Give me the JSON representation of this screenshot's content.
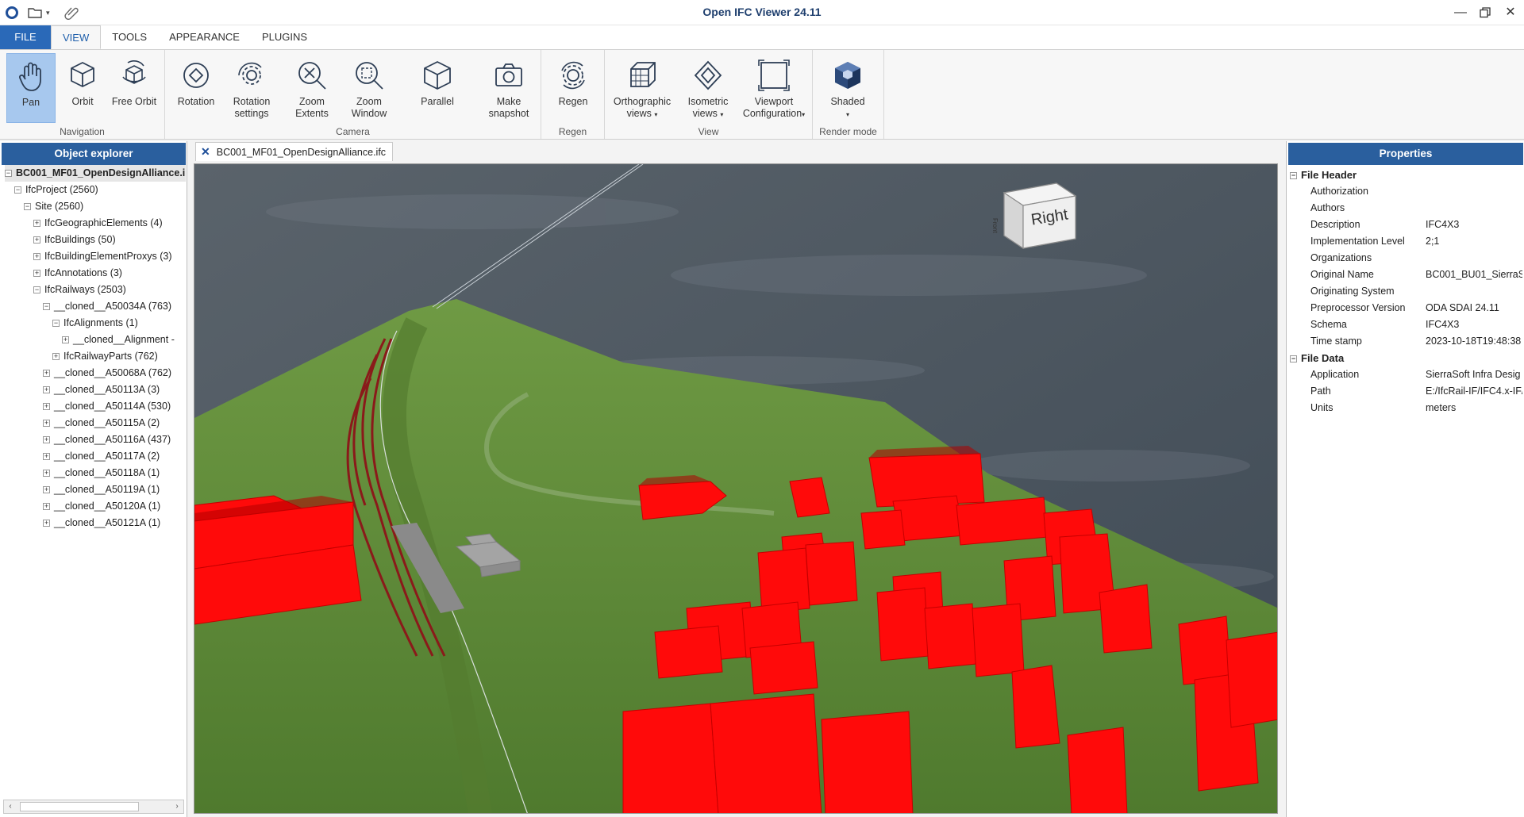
{
  "window": {
    "title": "Open IFC Viewer 24.11"
  },
  "tabs": [
    "FILE",
    "VIEW",
    "TOOLS",
    "APPEARANCE",
    "PLUGINS"
  ],
  "ribbon": {
    "groups": {
      "navigation": "Navigation",
      "camera": "Camera",
      "regen": "Regen",
      "view": "View",
      "render_mode": "Render mode"
    },
    "buttons": {
      "pan": "Pan",
      "orbit": "Orbit",
      "free_orbit": "Free Orbit",
      "rotation": "Rotation",
      "rotation_settings_1": "Rotation",
      "rotation_settings_2": "settings",
      "zoom_extents_1": "Zoom",
      "zoom_extents_2": "Extents",
      "zoom_window_1": "Zoom",
      "zoom_window_2": "Window",
      "parallel": "Parallel",
      "make_snapshot_1": "Make",
      "make_snapshot_2": "snapshot",
      "regen": "Regen",
      "ortho_1": "Orthographic",
      "ortho_2": "views",
      "iso_1": "Isometric",
      "iso_2": "views",
      "vpconf_1": "Viewport",
      "vpconf_2": "Configuration",
      "shaded": "Shaded"
    }
  },
  "object_explorer": {
    "title": "Object explorer",
    "tree": [
      {
        "label": "BC001_MF01_OpenDesignAlliance.i",
        "level": 0,
        "exp": "−",
        "bold": true
      },
      {
        "label": "IfcProject (2560)",
        "level": 1,
        "exp": "−"
      },
      {
        "label": "Site (2560)",
        "level": 2,
        "exp": "−"
      },
      {
        "label": "IfcGeographicElements (4)",
        "level": 3,
        "exp": "+"
      },
      {
        "label": "IfcBuildings (50)",
        "level": 3,
        "exp": "+"
      },
      {
        "label": "IfcBuildingElementProxys (3)",
        "level": 3,
        "exp": "+"
      },
      {
        "label": "IfcAnnotations (3)",
        "level": 3,
        "exp": "+"
      },
      {
        "label": "IfcRailways (2503)",
        "level": 3,
        "exp": "−"
      },
      {
        "label": "__cloned__A50034A (763)",
        "level": 4,
        "exp": "−"
      },
      {
        "label": "IfcAlignments (1)",
        "level": 5,
        "exp": "−"
      },
      {
        "label": "__cloned__Alignment -",
        "level": 6,
        "exp": "+"
      },
      {
        "label": "IfcRailwayParts (762)",
        "level": 5,
        "exp": "+"
      },
      {
        "label": "__cloned__A50068A (762)",
        "level": 4,
        "exp": "+"
      },
      {
        "label": "__cloned__A50113A (3)",
        "level": 4,
        "exp": "+"
      },
      {
        "label": "__cloned__A50114A (530)",
        "level": 4,
        "exp": "+"
      },
      {
        "label": "__cloned__A50115A (2)",
        "level": 4,
        "exp": "+"
      },
      {
        "label": "__cloned__A50116A (437)",
        "level": 4,
        "exp": "+"
      },
      {
        "label": "__cloned__A50117A (2)",
        "level": 4,
        "exp": "+"
      },
      {
        "label": "__cloned__A50118A (1)",
        "level": 4,
        "exp": "+"
      },
      {
        "label": "__cloned__A50119A (1)",
        "level": 4,
        "exp": "+"
      },
      {
        "label": "__cloned__A50120A (1)",
        "level": 4,
        "exp": "+"
      },
      {
        "label": "__cloned__A50121A (1)",
        "level": 4,
        "exp": "+"
      }
    ]
  },
  "document": {
    "tab_label": "BC001_MF01_OpenDesignAlliance.ifc",
    "viewcube_label": "Right",
    "viewcube_side_label": "Front"
  },
  "properties": {
    "title": "Properties",
    "sections": [
      {
        "name": "File Header",
        "rows": [
          {
            "key": "Authorization",
            "value": ""
          },
          {
            "key": "Authors",
            "value": ""
          },
          {
            "key": "Description",
            "value": "IFC4X3"
          },
          {
            "key": "Implementation Level",
            "value": "2;1"
          },
          {
            "key": "Organizations",
            "value": ""
          },
          {
            "key": "Original Name",
            "value": "BC001_BU01_SierraSo"
          },
          {
            "key": "Originating System",
            "value": ""
          },
          {
            "key": "Preprocessor Version",
            "value": "ODA SDAI 24.11"
          },
          {
            "key": "Schema",
            "value": "IFC4X3"
          },
          {
            "key": "Time stamp",
            "value": "2023-10-18T19:48:38"
          }
        ]
      },
      {
        "name": "File Data",
        "rows": [
          {
            "key": "Application",
            "value": "SierraSoft Infra Desig"
          },
          {
            "key": "Path",
            "value": "E:/IfcRail-IF/IFC4.x-IF/"
          },
          {
            "key": "Units",
            "value": "meters"
          }
        ]
      }
    ]
  },
  "colors": {
    "accent": "#2a5f9e",
    "file_tab": "#2a69b8",
    "terrain": "#5f8a3a",
    "buildings": "#ff0a0a",
    "sky": "#4b5560"
  }
}
